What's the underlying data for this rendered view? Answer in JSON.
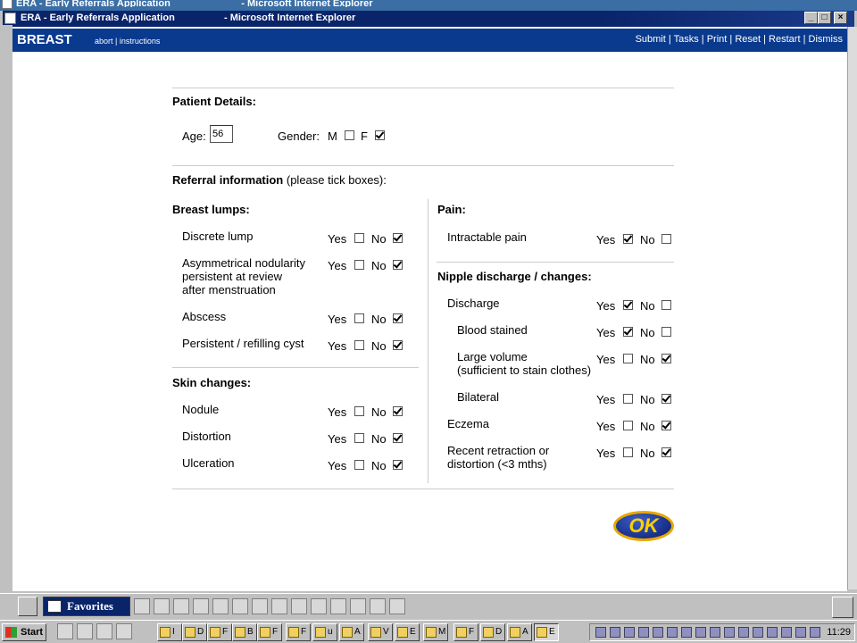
{
  "window": {
    "title_left": "ERA - Early Referrals Application",
    "title_right": "- Microsoft Internet Explorer",
    "min_label": "_",
    "max_label": "□",
    "close_label": "×"
  },
  "header": {
    "title": "BREAST",
    "sublinks": [
      "abort",
      "instructions"
    ],
    "sublink_sep": " | ",
    "actions": [
      "Submit",
      "Tasks",
      "Print",
      "Reset",
      "Restart",
      "Dismiss"
    ],
    "action_sep": " | "
  },
  "patient": {
    "title": "Patient Details:",
    "age_label": "Age:",
    "age_value": "56",
    "gender_label": "Gender:",
    "gender_m": "M",
    "gender_f": "F",
    "gender_m_checked": false,
    "gender_f_checked": true
  },
  "referral": {
    "title": "Referral information",
    "subtitle": "(please tick boxes):",
    "yes_label": "Yes",
    "no_label": "No"
  },
  "breast_lumps": {
    "title": "Breast lumps:",
    "items": [
      {
        "lines": [
          "Discrete lump"
        ],
        "yes": false,
        "no": true
      },
      {
        "lines": [
          "Asymmetrical nodularity",
          "persistent at review",
          "after menstruation"
        ],
        "yes": false,
        "no": true
      },
      {
        "lines": [
          "Abscess"
        ],
        "yes": false,
        "no": true
      },
      {
        "lines": [
          "Persistent / refilling cyst"
        ],
        "yes": false,
        "no": true
      }
    ]
  },
  "skin_changes": {
    "title": "Skin changes:",
    "items": [
      {
        "lines": [
          "Nodule"
        ],
        "yes": false,
        "no": true
      },
      {
        "lines": [
          "Distortion"
        ],
        "yes": false,
        "no": true
      },
      {
        "lines": [
          "Ulceration"
        ],
        "yes": false,
        "no": true
      }
    ]
  },
  "pain": {
    "title": "Pain:",
    "items": [
      {
        "lines": [
          "Intractable pain"
        ],
        "yes": true,
        "no": false
      }
    ]
  },
  "nipple": {
    "title": "Nipple discharge / changes:",
    "items": [
      {
        "lines": [
          "Discharge"
        ],
        "yes": true,
        "no": false
      },
      {
        "lines": [
          "Blood stained"
        ],
        "yes": true,
        "no": false
      },
      {
        "lines": [
          "Large volume",
          "(sufficient to stain clothes)"
        ],
        "yes": false,
        "no": true
      },
      {
        "lines": [
          "Bilateral"
        ],
        "yes": false,
        "no": true
      },
      {
        "lines": [
          "Eczema"
        ],
        "yes": false,
        "no": true
      },
      {
        "lines": [
          "Recent retraction or",
          "distortion (<3 mths)"
        ],
        "yes": false,
        "no": true
      }
    ]
  },
  "ok_button": {
    "label": "OK"
  },
  "favbar": {
    "favorites_label": "Favorites"
  },
  "taskbar": {
    "start_label": "Start",
    "clock": "11:29",
    "task_buttons": [
      "I",
      "D",
      "F",
      "B",
      "F",
      "F",
      "u",
      "A",
      "V",
      "E",
      "M",
      "F",
      "D",
      "A",
      "E"
    ]
  }
}
